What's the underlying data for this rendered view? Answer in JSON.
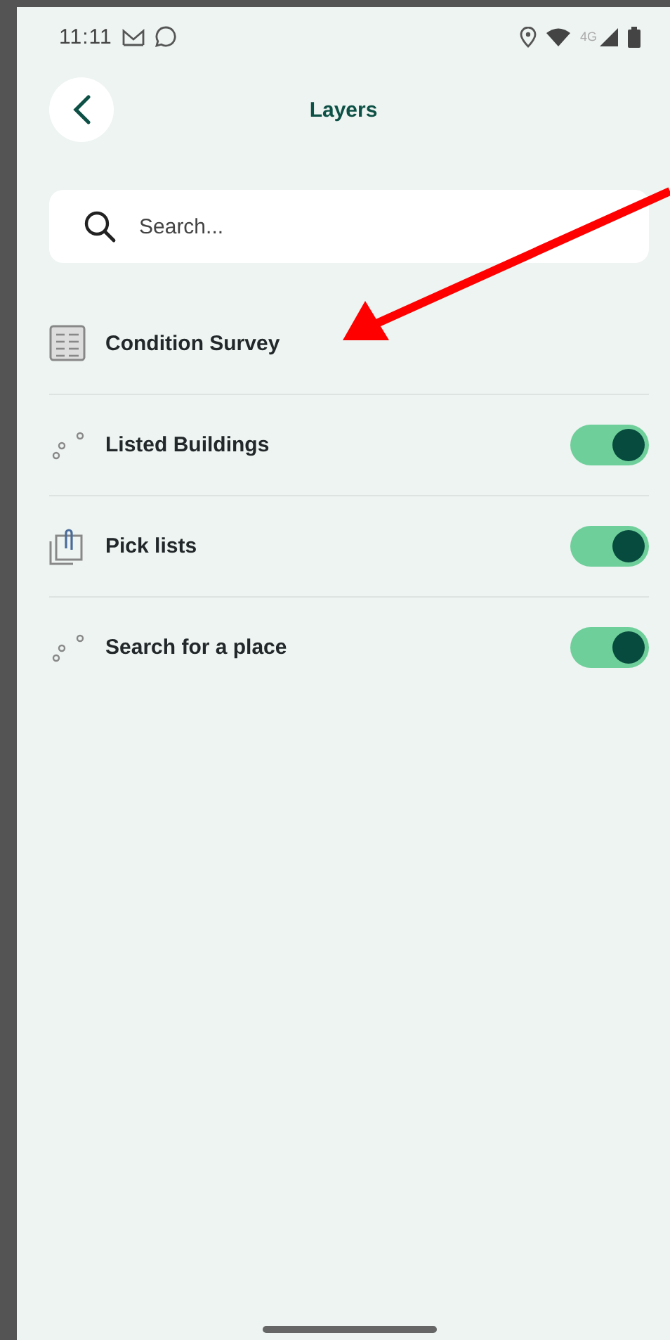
{
  "status_bar": {
    "time": "11:11",
    "network": "4G"
  },
  "header": {
    "title": "Layers"
  },
  "search": {
    "placeholder": "Search..."
  },
  "layers": [
    {
      "kind": "table",
      "name": "Condition Survey"
    },
    {
      "kind": "points",
      "name": "Listed Buildings",
      "on": true
    },
    {
      "kind": "picklist",
      "name": "Pick lists",
      "on": true
    },
    {
      "kind": "points",
      "name": "Search for a place",
      "on": true
    }
  ]
}
